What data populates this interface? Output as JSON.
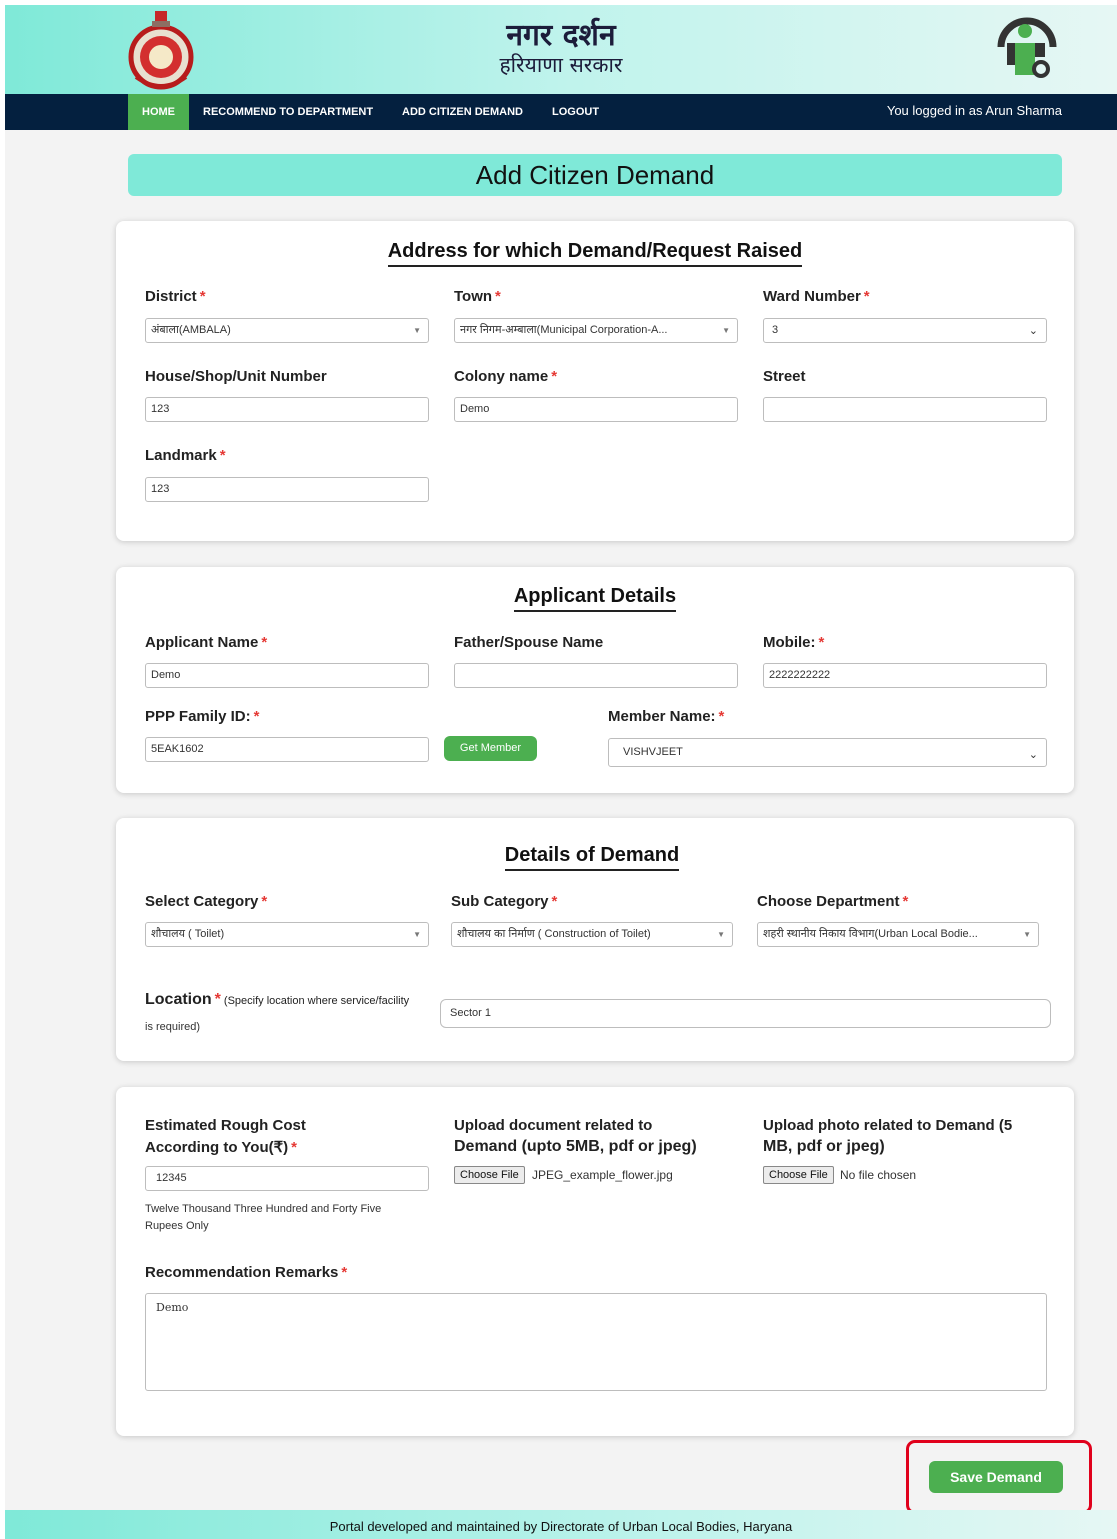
{
  "header": {
    "title": "नगर दर्शन",
    "subtitle": "हरियाणा सरकार"
  },
  "nav": {
    "home": "HOME",
    "recommend": "RECOMMEND TO DEPARTMENT",
    "add_demand": "ADD CITIZEN DEMAND",
    "logout": "LOGOUT",
    "user_text": "You logged in as Arun Sharma"
  },
  "page_title": "Add Citizen Demand",
  "address": {
    "title": "Address for which Demand/Request Raised",
    "district_label": "District",
    "district_value": "अंबाला(AMBALA)",
    "town_label": "Town",
    "town_value": "नगर निगम-अम्बाला(Municipal Corporation-A...",
    "ward_label": "Ward Number",
    "ward_value": "3",
    "house_label": "House/Shop/Unit Number",
    "house_value": "123",
    "colony_label": "Colony name",
    "colony_value": "Demo",
    "street_label": "Street",
    "street_value": "",
    "landmark_label": "Landmark",
    "landmark_value": "123"
  },
  "applicant": {
    "title": "Applicant Details",
    "name_label": "Applicant Name",
    "name_value": "Demo",
    "father_label": "Father/Spouse Name",
    "father_value": "",
    "mobile_label": "Mobile:",
    "mobile_value": "2222222222",
    "ppp_label": "PPP Family ID:",
    "ppp_value": "5EAK1602",
    "get_member_label": "Get Member",
    "member_label": "Member Name:",
    "member_value": "VISHVJEET"
  },
  "demand": {
    "title": "Details of Demand",
    "category_label": "Select Category",
    "category_value": "शौचालय ( Toilet)",
    "subcategory_label": "Sub Category",
    "subcategory_value": "शौचालय का निर्माण ( Construction of Toilet)",
    "department_label": "Choose Department",
    "department_value": "शहरी स्थानीय निकाय विभाग(Urban Local Bodie...",
    "location_label": "Location",
    "location_hint_1": "(Specify location where service/facility",
    "location_hint_2": "is required)",
    "location_value": "Sector 1"
  },
  "cost": {
    "cost_label_1": "Estimated Rough Cost",
    "cost_label_2": "According to You(₹)",
    "cost_value": "12345",
    "cost_words_1": "Twelve Thousand Three Hundred and Forty Five",
    "cost_words_2": "Rupees Only",
    "doc_label_1": "Upload document related to",
    "doc_label_2": "Demand (upto 5MB, pdf or jpeg)",
    "doc_button": "Choose File",
    "doc_file": "JPEG_example_flower.jpg",
    "photo_label_1": "Upload photo related to Demand (5",
    "photo_label_2": "MB, pdf or jpeg)",
    "photo_button": "Choose File",
    "photo_file": "No file chosen",
    "remarks_label": "Recommendation Remarks",
    "remarks_value": "Demo"
  },
  "save_button": "Save Demand",
  "footer": "Portal developed and maintained by Directorate of Urban Local Bodies, Haryana",
  "colors": {
    "header_bg": "#7fe9d8",
    "nav_bg": "#04203f",
    "accent_green": "#4caf50",
    "required_red": "#e53935",
    "highlight_red": "#e0001b"
  },
  "icons": {
    "left_logo": "haryana-emblem-icon",
    "right_logo": "info-logo-icon"
  }
}
